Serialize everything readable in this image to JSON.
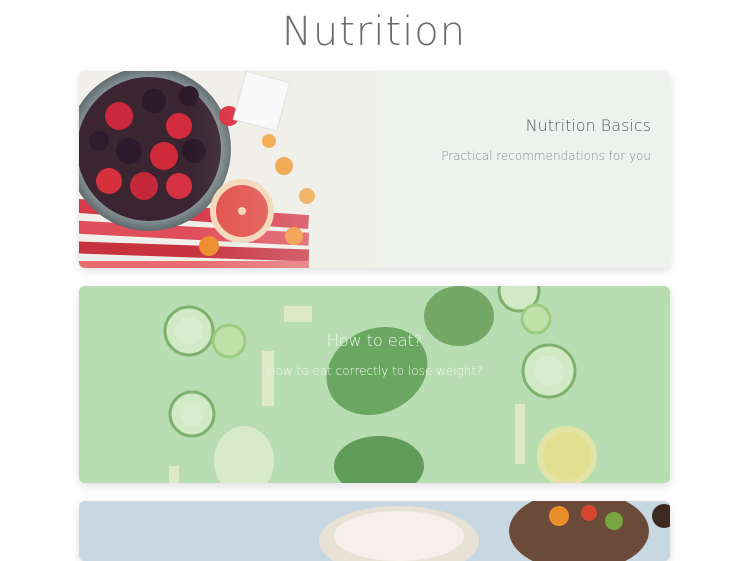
{
  "page": {
    "title": "Nutrition"
  },
  "cards": [
    {
      "title": "Nutrition Basics",
      "subtitle": "Practical recommendations for you",
      "image": "fruit-bowl-image"
    },
    {
      "title": "How to eat?",
      "subtitle": "How to eat correctly to lose weight?",
      "image": "vegetables-image"
    },
    {
      "title": "",
      "subtitle": "",
      "image": "food-bowls-image"
    }
  ],
  "colors": {
    "title_text": "#6b6b6b",
    "card1_overlay": "#eef1ef",
    "card2_overlay": "#b9ddb3"
  }
}
